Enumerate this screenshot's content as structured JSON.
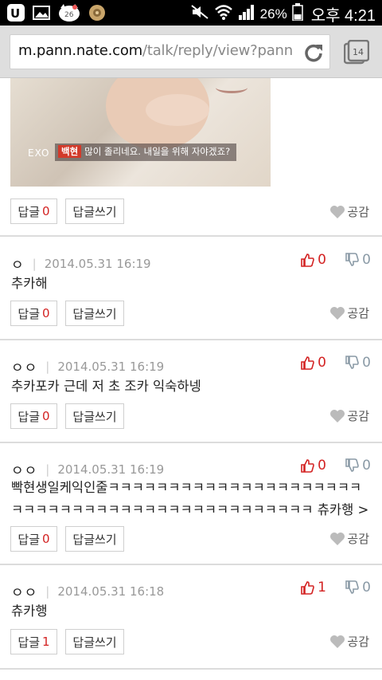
{
  "status_bar": {
    "battery": "26%",
    "time": "오후 4:21",
    "notification_badge": "26",
    "icons": [
      "u-plus-icon",
      "image-icon",
      "hello-kitty-icon",
      "flower-icon",
      "mute-icon",
      "wifi-icon",
      "signal-icon",
      "battery-icon"
    ]
  },
  "address_bar": {
    "url_host": "m.pann.nate.com",
    "url_path": "/talk/reply/view?pann",
    "tab_count": "14"
  },
  "photo": {
    "logo": "EXO",
    "caption_name": "백현",
    "caption_text": "많이 졸리네요. 내일을 위해 자야겠죠?"
  },
  "labels": {
    "reply": "답글",
    "write_reply": "답글쓰기",
    "like": "공감"
  },
  "post_actions": {
    "reply_count": "0"
  },
  "comments": [
    {
      "author": "ㅇ",
      "date": "2014.05.31 16:19",
      "up": "0",
      "down": "0",
      "text": "추카해",
      "reply_count": "0"
    },
    {
      "author": "ㅇㅇ",
      "date": "2014.05.31 16:19",
      "up": "0",
      "down": "0",
      "text": "추카포카 근데 저 초 조카 익숙하넹",
      "reply_count": "0"
    },
    {
      "author": "ㅇㅇ",
      "date": "2014.05.31 16:19",
      "up": "0",
      "down": "0",
      "text": "빡현생일케익인줄ㅋㅋㅋㅋㅋㅋㅋㅋㅋㅋㅋㅋㅋㅋㅋㅋㅋㅋㅋㅋㅋㅋㅋㅋㅋㅋㅋㅋㅋㅋㅋㅋㅋㅋㅋㅋㅋㅋㅋㅋㅋㅋㅋㅋㅋㅋ 츄카행 ><",
      "reply_count": "0"
    },
    {
      "author": "ㅇㅇ",
      "date": "2014.05.31 16:18",
      "up": "1",
      "down": "0",
      "text": "츄카행",
      "reply_count": "1"
    }
  ],
  "colors": {
    "count_red": "#d32222",
    "divider": "#dcdcdc",
    "status_bar": "#000000"
  }
}
